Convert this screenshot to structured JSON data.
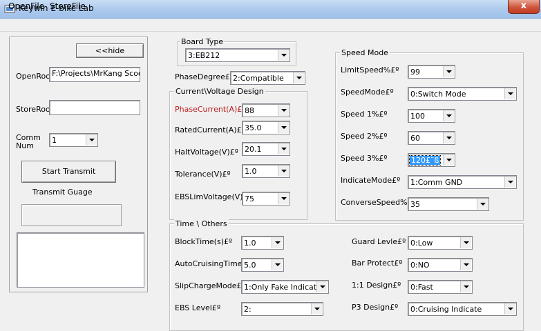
{
  "window": {
    "title": "Keywin E-bike Lab",
    "close_glyph": "x"
  },
  "menu": [
    "OpenFile",
    "StoreFile"
  ],
  "left": {
    "hide_button": "<<hide",
    "open_root_label": "OpenRoot",
    "open_root_value": "F:\\Projects\\MrKang Scooter",
    "store_root_label": "StoreRoot",
    "store_root_value": "",
    "comm_label_1": "Comm",
    "comm_label_2": "Num",
    "comm_value": "1",
    "start_button": "Start Transmit",
    "gauge_label": "Transmit Guage"
  },
  "board": {
    "group_title": "Board Type",
    "board_value": "3:EB212",
    "phase_degree_label": "PhaseDegree£º",
    "phase_degree_value": "2:Compatible"
  },
  "current": {
    "group_title": "Current\\Voltage Design",
    "phase_current_label": "PhaseCurrent(A)£º",
    "phase_current_value": "88",
    "rated_current_label": "RatedCurrent(A)£º",
    "rated_current_value": "35.0",
    "halt_voltage_label": "HaltVoltage(V)£º",
    "halt_voltage_value": "20.1",
    "tolerance_label": "Tolerance(V)£º",
    "tolerance_value": "1.0",
    "ebs_lim_label": "EBSLimVoltage(V)£º",
    "ebs_lim_value": "75"
  },
  "speed": {
    "group_title": "Speed Mode",
    "limit_label": "LimitSpeed%£º",
    "limit_value": "99",
    "mode_label": "SpeedMode£º",
    "mode_value": "0:Switch Mode",
    "s1_label": "Speed 1%£º",
    "s1_value": "100",
    "s2_label": "Speed 2%£º",
    "s2_value": "60",
    "s3_label": "Speed 3%£º",
    "s3_value": "120£¨ß",
    "indicate_label": "IndicateMode£º",
    "indicate_value": "1:Comm GND",
    "converse_label": "ConverseSpeed%",
    "converse_value": "35"
  },
  "time": {
    "group_title": "Time \\ Others",
    "block_label": "BlockTime(s)£º",
    "block_value": "1.0",
    "cruise_label": "AutoCruisingTime(s)£º",
    "cruise_value": "5.0",
    "slip_label": "SlipChargeMode£º",
    "slip_value": "1:Only Fake Indicate",
    "ebs_level_label": "EBS Level£º",
    "ebs_level_value": "2:",
    "guard_label": "Guard Levle£º",
    "guard_value": "0:Low",
    "bar_label": "Bar Protect£º",
    "bar_value": "0:NO",
    "design11_label": "1:1 Design£º",
    "design11_value": "0:Fast",
    "p3_label": "P3 Design£º",
    "p3_value": "0:Cruising Indicate"
  },
  "icons": {
    "app": "app-icon",
    "dropdown": "chevron-down-icon",
    "close": "close-icon"
  }
}
